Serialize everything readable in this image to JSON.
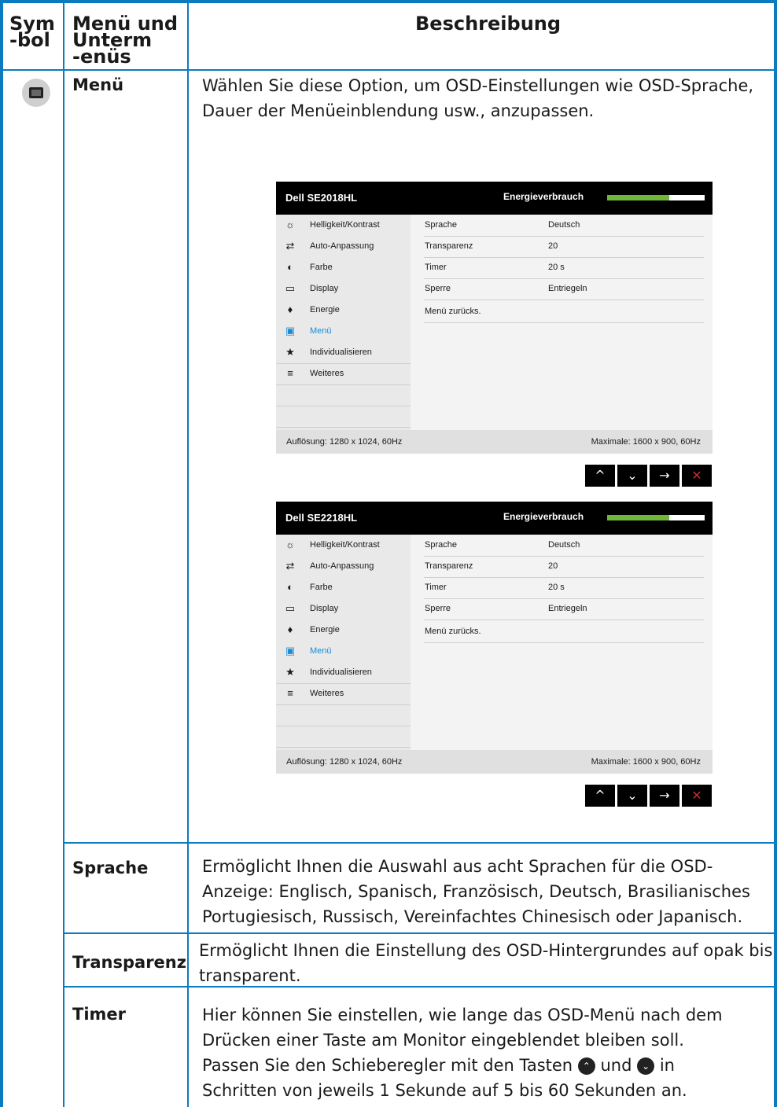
{
  "header": {
    "col1_line1": "Sym",
    "col1_line2": "-bol",
    "col2_line1": "Menü und",
    "col2_line2": "Unterm",
    "col2_line3": "-enüs",
    "col3": "Beschreibung"
  },
  "rows": [
    {
      "title": "Menü",
      "desc_line1": "Wählen Sie diese Option, um OSD-Einstellungen wie OSD-Sprache,",
      "desc_line2": "Dauer der Menüeinblendung usw., anzupassen."
    },
    {
      "title": "Sprache",
      "desc_line1": "Ermöglicht Ihnen die Auswahl aus acht Sprachen für die OSD-",
      "desc_line2": "Anzeige: Englisch, Spanisch, Französisch, Deutsch, Brasilianisches",
      "desc_line3": "Portugiesisch, Russisch, Vereinfachtes Chinesisch oder Japanisch."
    },
    {
      "title": "Transparenz",
      "desc_line1": "Ermöglicht Ihnen die Einstellung des OSD-Hintergrundes auf opak bis",
      "desc_line2": "transparent."
    },
    {
      "title": "Timer",
      "desc_line1": "Hier können Sie einstellen, wie lange das OSD-Menü nach dem",
      "desc_line2": "Drücken einer Taste am Monitor eingeblendet bleiben soll.",
      "desc_line3_a": "Passen Sie den Schieberegler mit den Tasten",
      "desc_line3_b": "und",
      "desc_line3_c": "in",
      "desc_line4": "Schritten von jeweils 1 Sekunde auf 5 bis 60 Sekunden an."
    }
  ],
  "osd_common": {
    "energy_label": "Energieverbrauch",
    "energy_level": 0.64,
    "menu_items": [
      {
        "icon": "☼",
        "label": "Helligkeit/Kontrast"
      },
      {
        "icon": "⇄",
        "label": "Auto-Anpassung"
      },
      {
        "icon": "◐",
        "label": "Farbe"
      },
      {
        "icon": "▭",
        "label": "Display"
      },
      {
        "icon": "♦",
        "label": "Energie"
      },
      {
        "icon": "▣",
        "label": "Menü"
      },
      {
        "icon": "★",
        "label": "Individualisieren"
      },
      {
        "icon": "≡",
        "label": "Weiteres"
      }
    ],
    "settings": [
      {
        "key": "Sprache",
        "value": "Deutsch"
      },
      {
        "key": "Transparenz",
        "value": "20"
      },
      {
        "key": "Timer",
        "value": "20 s"
      },
      {
        "key": "Sperre",
        "value": "Entriegeln"
      },
      {
        "key": "Menü zurücks.",
        "value": ""
      }
    ],
    "footer_left": "Auflösung: 1280 x 1024, 60Hz",
    "footer_right": "Maximale: 1600 x 900, 60Hz",
    "buttons": [
      "^",
      "⌄",
      "→",
      "✕"
    ]
  },
  "osd1": {
    "model": "Dell SE2018HL"
  },
  "osd2": {
    "model": "Dell SE2218HL"
  },
  "colors": {
    "accent": "#0c7abf",
    "active": "#1a8bd6",
    "energy": "#6fb63a"
  }
}
